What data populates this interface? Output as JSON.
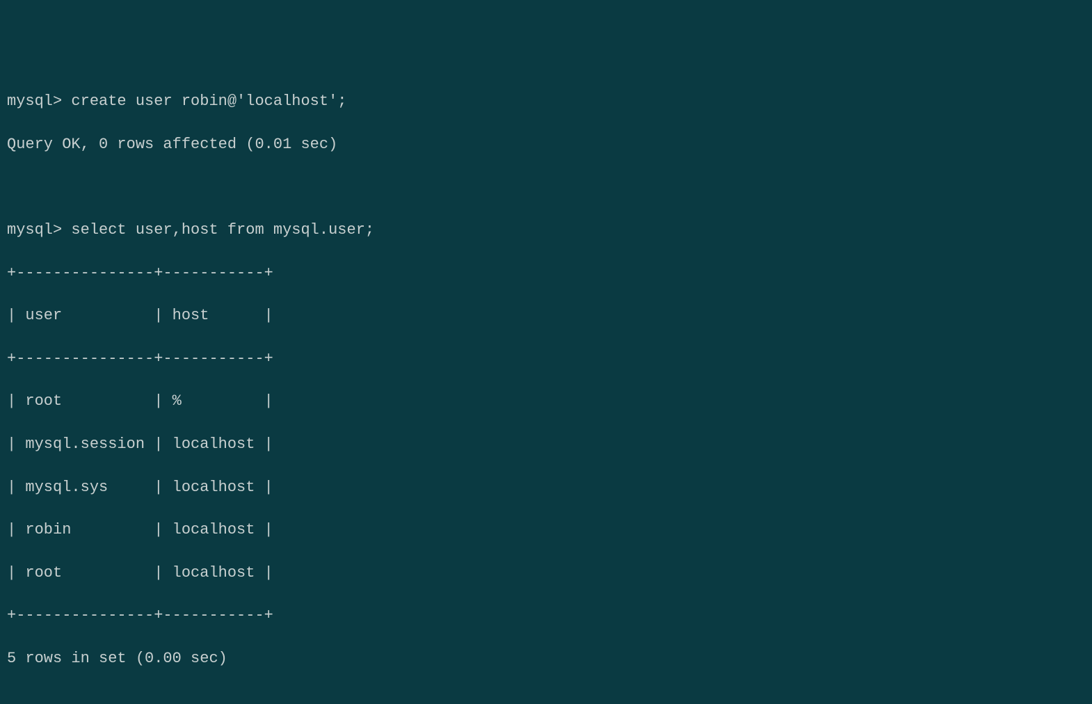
{
  "terminal": {
    "prompt": "mysql>",
    "sessions": [
      {
        "command": "create user robin@'localhost';",
        "result": "Query OK, 0 rows affected (0.01 sec)"
      },
      {
        "command": "select user,host from mysql.user;",
        "table": {
          "border_top": "+---------------+-----------+",
          "header": "| user          | host      |",
          "border_mid": "+---------------+-----------+",
          "rows": [
            "| root          | %         |",
            "| mysql.session | localhost |",
            "| mysql.sys     | localhost |",
            "| robin         | localhost |",
            "| root          | localhost |"
          ],
          "border_bot": "+---------------+-----------+"
        },
        "result": "5 rows in set (0.00 sec)"
      }
    ]
  },
  "chart_data": {
    "type": "table",
    "title": "mysql.user",
    "columns": [
      "user",
      "host"
    ],
    "rows": [
      [
        "root",
        "%"
      ],
      [
        "mysql.session",
        "localhost"
      ],
      [
        "mysql.sys",
        "localhost"
      ],
      [
        "robin",
        "localhost"
      ],
      [
        "root",
        "localhost"
      ]
    ]
  }
}
